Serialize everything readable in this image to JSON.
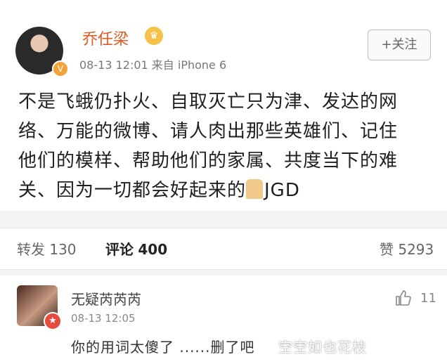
{
  "post": {
    "username": "乔任梁",
    "timestamp": "08-13 12:01",
    "source": "来自 iPhone 6",
    "follow_label": "+关注",
    "content_lines": [
      "不是飞蛾仍扑火、自取灭亡只为津、发达的网",
      "络、万能的微博、请人肉出那些英雄们、记住",
      "他们的模样、帮助他们的家属、共度当下的难",
      "关、因为一切都会好起来的"
    ],
    "content_suffix": "JGD"
  },
  "stats": {
    "repost_label": "转发",
    "repost_count": "130",
    "comment_label": "评论",
    "comment_count": "400",
    "like_label": "赞",
    "like_count": "5293"
  },
  "comment": {
    "username": "无疑芮芮芮",
    "timestamp": "08-13 12:05",
    "like_count": "11",
    "text": "你的用词太傻了 ......删了吧",
    "watermark": "空空如也花枝"
  },
  "icons": {
    "verified": "verified-badge-icon",
    "crown": "crown-icon",
    "pray": "praying-hands-icon",
    "thumb": "thumbs-up-icon"
  }
}
